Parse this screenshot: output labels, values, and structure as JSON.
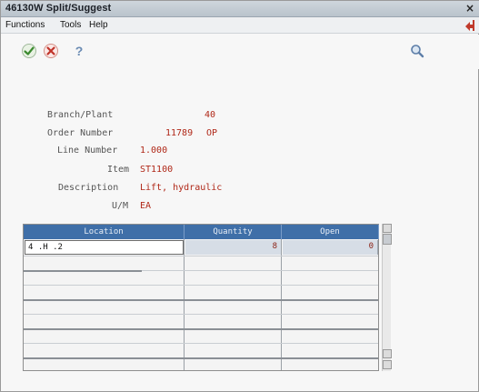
{
  "window": {
    "title": "46130W  Split/Suggest",
    "close_glyph": "×"
  },
  "menu": {
    "items": [
      "Functions",
      "Tools",
      "Help"
    ]
  },
  "toolbar": {
    "ok_icon": "check-icon",
    "cancel_icon": "cancel-x-icon",
    "help_glyph": "?",
    "search_icon": "magnifier-icon"
  },
  "fields": {
    "branch_plant": {
      "label": "Branch/Plant",
      "value": "40"
    },
    "order_number": {
      "label": "Order Number",
      "value": "11789",
      "type": "OP"
    },
    "line_number": {
      "label": "Line Number",
      "value": "1.000"
    },
    "item": {
      "label": "Item",
      "value": "ST1100"
    },
    "description": {
      "label": "Description",
      "value": "Lift, hydraulic"
    },
    "um": {
      "label": "U/M",
      "value": "EA"
    }
  },
  "grid": {
    "columns": [
      "Location",
      "Quantity",
      "Open"
    ],
    "rows": [
      {
        "location": "4 .H  .2",
        "quantity": "8",
        "open": "0"
      }
    ]
  },
  "colors": {
    "header_bg": "#3f6fa8",
    "value_text": "#b02818",
    "title_bar": "#c4ccd5"
  }
}
